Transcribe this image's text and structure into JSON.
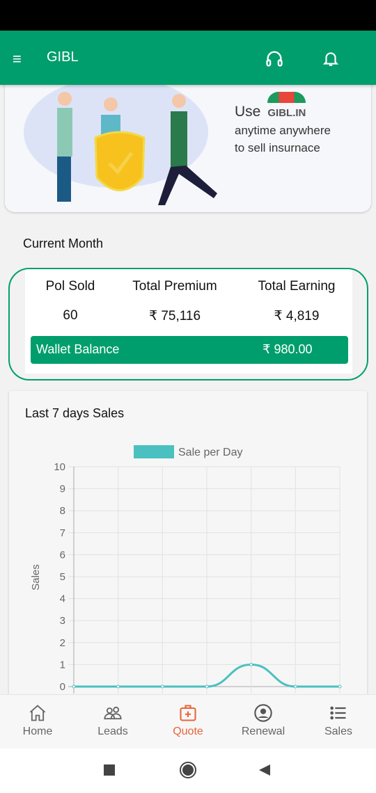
{
  "header": {
    "title": "GIBL",
    "menu_icon": "hamburger-icon",
    "support_icon": "headphones-icon",
    "notification_icon": "bell-icon"
  },
  "banner": {
    "use": "Use",
    "logo": "GIBL.IN",
    "line1": "anytime anywhere",
    "line2": "to sell insurnace"
  },
  "current_month": {
    "label": "Current Month",
    "stats": [
      {
        "label": "Pol Sold",
        "value": "60"
      },
      {
        "label": "Total Premium",
        "value": "₹ 75,116"
      },
      {
        "label": "Total Earning",
        "value": "₹ 4,819"
      }
    ],
    "wallet_label": "Wallet Balance",
    "wallet_value": "₹ 980.00"
  },
  "chart_card": {
    "title": "Last 7 days Sales"
  },
  "chart_data": {
    "type": "line",
    "legend": [
      "Sale per Day"
    ],
    "ylabel": "Sales",
    "ylim": [
      0,
      10
    ],
    "yticks": [
      "0",
      "1",
      "2",
      "3",
      "4",
      "5",
      "6",
      "7",
      "8",
      "9",
      "10"
    ],
    "series": [
      {
        "name": "Sale per Day",
        "values": [
          0,
          0,
          0,
          0,
          1,
          0,
          0
        ],
        "color": "#4bc0c0"
      }
    ],
    "grid": true,
    "legend_position": "top"
  },
  "nav": {
    "items": [
      {
        "label": "Home",
        "icon": "home-icon"
      },
      {
        "label": "Leads",
        "icon": "people-icon"
      },
      {
        "label": "Quote",
        "icon": "medical-kit-icon",
        "active": true
      },
      {
        "label": "Renewal",
        "icon": "user-circle-icon"
      },
      {
        "label": "Sales",
        "icon": "list-icon"
      }
    ]
  },
  "colors": {
    "primary": "#009e6c",
    "active": "#e8643c",
    "series": "#4bc0c0"
  }
}
